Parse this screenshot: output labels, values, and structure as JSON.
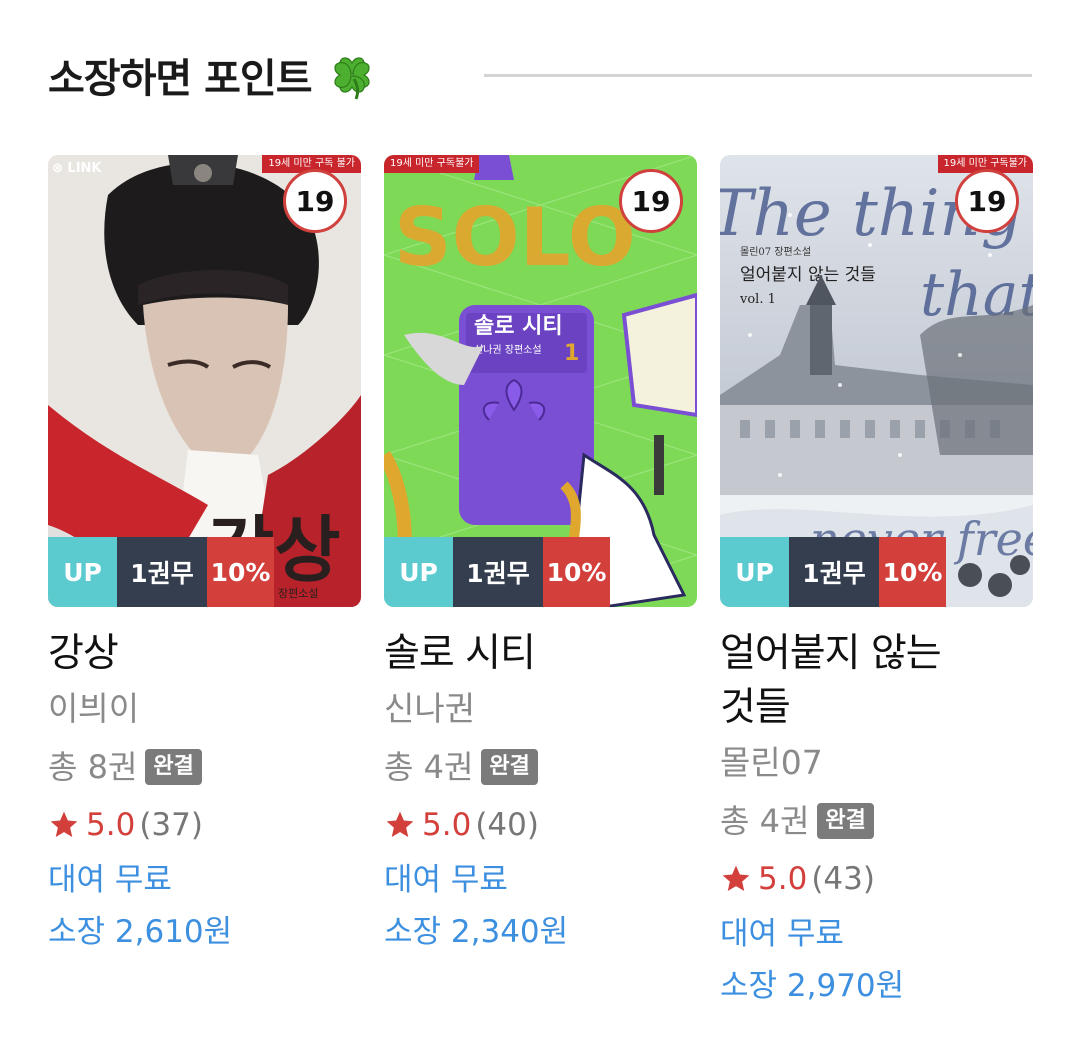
{
  "section": {
    "title": "소장하면 포인트",
    "icon": "four-leaf-clover-icon"
  },
  "tags": {
    "up": "UP",
    "free": "1권무",
    "discount": "10%"
  },
  "books": [
    {
      "title": "강상",
      "author": "이븨이",
      "volumes": "총 8권",
      "status": "완결",
      "age": "19",
      "age_ribbon": "19세 미만 구독 불가",
      "publisher_logo": "LINK",
      "cover_text": "강상",
      "rating": "5.0",
      "rating_count": "(37)",
      "rent": "대여 무료",
      "own": "소장 2,610원"
    },
    {
      "title": "솔로 시티",
      "author": "신나권",
      "volumes": "총 4권",
      "status": "완결",
      "age": "19",
      "age_ribbon": "19세 미만 구독불가",
      "publisher_logo": "",
      "cover_text": "솔로 시티",
      "cover_subtext": "신나권 장편소설",
      "rating": "5.0",
      "rating_count": "(40)",
      "rent": "대여 무료",
      "own": "소장 2,340원"
    },
    {
      "title": "얼어붙지 않는 것들",
      "title_line1": "얼어붙지 않는",
      "title_line2": "것들",
      "author": "몰린07",
      "volumes": "총 4권",
      "status": "완결",
      "age": "19",
      "age_ribbon": "19세 미만 구독불가",
      "publisher_logo": "",
      "cover_text": "얼어붙지 않는 것들",
      "cover_subtext": "몰린07 장편소설",
      "cover_volume": "vol. 1",
      "cover_script": "The things that never freeze",
      "rating": "5.0",
      "rating_count": "(43)",
      "rent": "대여 무료",
      "own": "소장 2,970원"
    }
  ],
  "colors": {
    "tag_up": "#5ccbd0",
    "tag_free": "#343e4e",
    "tag_discount": "#d33f3b",
    "price_blue": "#3d8fe0",
    "rating_red": "#d33f3b",
    "complete_gray": "#7b7b7b"
  }
}
